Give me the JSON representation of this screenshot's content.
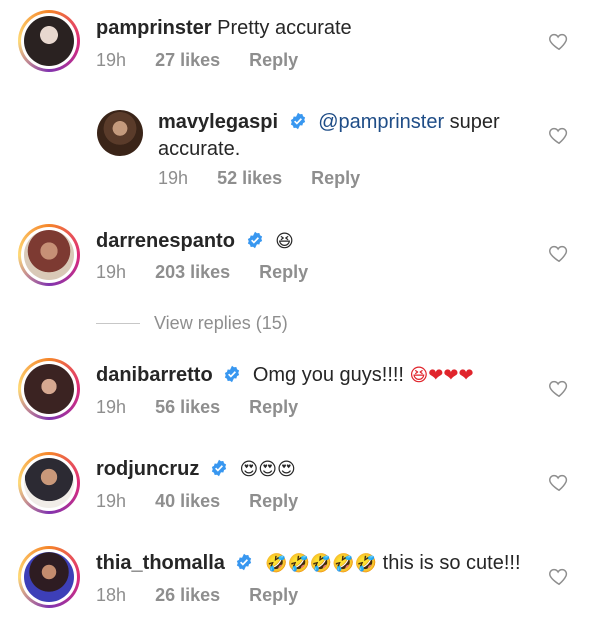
{
  "comments": [
    {
      "username": "pamprinster",
      "text": "Pretty accurate",
      "time": "19h",
      "likes": "27 likes",
      "reply": "Reply"
    },
    {
      "username": "mavylegaspi",
      "mention": "@pamprinster",
      "text": " super",
      "text2": "accurate.",
      "time": "19h",
      "likes": "52 likes",
      "reply": "Reply"
    },
    {
      "username": "darrenespanto",
      "text": "😆",
      "time": "19h",
      "likes": "203 likes",
      "reply": "Reply",
      "view_replies": "View replies (15)"
    },
    {
      "username": "danibarretto",
      "text": "Omg you guys!!!! ",
      "emojis": "😆❤❤❤",
      "time": "19h",
      "likes": "56 likes",
      "reply": "Reply"
    },
    {
      "username": "rodjuncruz",
      "emojis": "😍😍😍",
      "time": "19h",
      "likes": "40 likes",
      "reply": "Reply"
    },
    {
      "username": "thia_thomalla",
      "emojis": "🤣🤣🤣🤣🤣",
      "text": " this is so cute!!!",
      "time": "18h",
      "likes": "26 likes",
      "reply": "Reply"
    }
  ],
  "colors": {
    "verified": "#3897f0",
    "mention": "#1f4d87",
    "meta": "#8e8e8e"
  }
}
